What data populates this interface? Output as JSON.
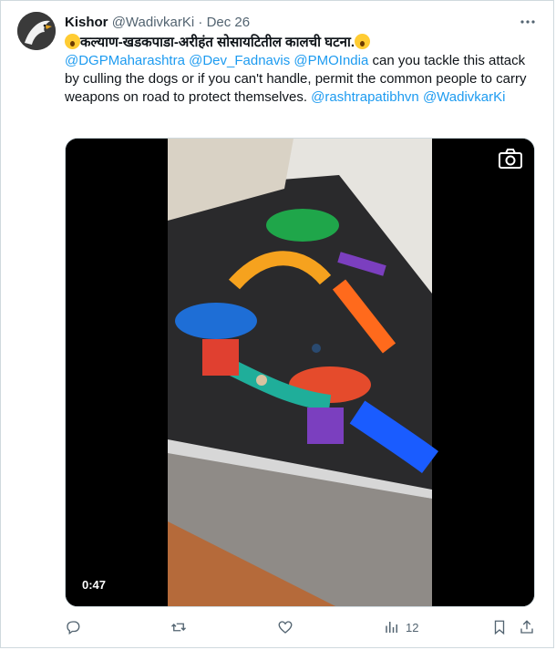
{
  "tweet": {
    "author_name": "Kishor",
    "handle": "@WadivkarKi",
    "separator": "·",
    "date": "Dec 26",
    "more_icon": "more-icon",
    "title": "कल्याण-खडकपाडा-अरीहंत सोसायटितील कालची घटना.",
    "mentions": [
      "@DGPMaharashtra",
      "@Dev_Fadnavis",
      "@PMOIndia"
    ],
    "body": " can you tackle this attack by culling the dogs or if you can't handle, permit the common people to carry weapons on road to protect themselves. ",
    "trailing_mentions": [
      "@rashtrapatibhvn",
      "@WadivkarKi"
    ],
    "emoji": "screaming-face-emoji"
  },
  "media": {
    "type": "video",
    "duration": "0:47",
    "camera_icon": "camera-icon"
  },
  "actions": {
    "reply_icon": "reply-icon",
    "retweet_icon": "retweet-icon",
    "like_icon": "heart-icon",
    "views_icon": "views-icon",
    "views_count": "12",
    "bookmark_icon": "bookmark-icon",
    "share_icon": "share-icon"
  },
  "colors": {
    "link": "#1d9bf0",
    "text": "#0f1419",
    "secondary": "#536471",
    "border": "#cfd9de"
  }
}
